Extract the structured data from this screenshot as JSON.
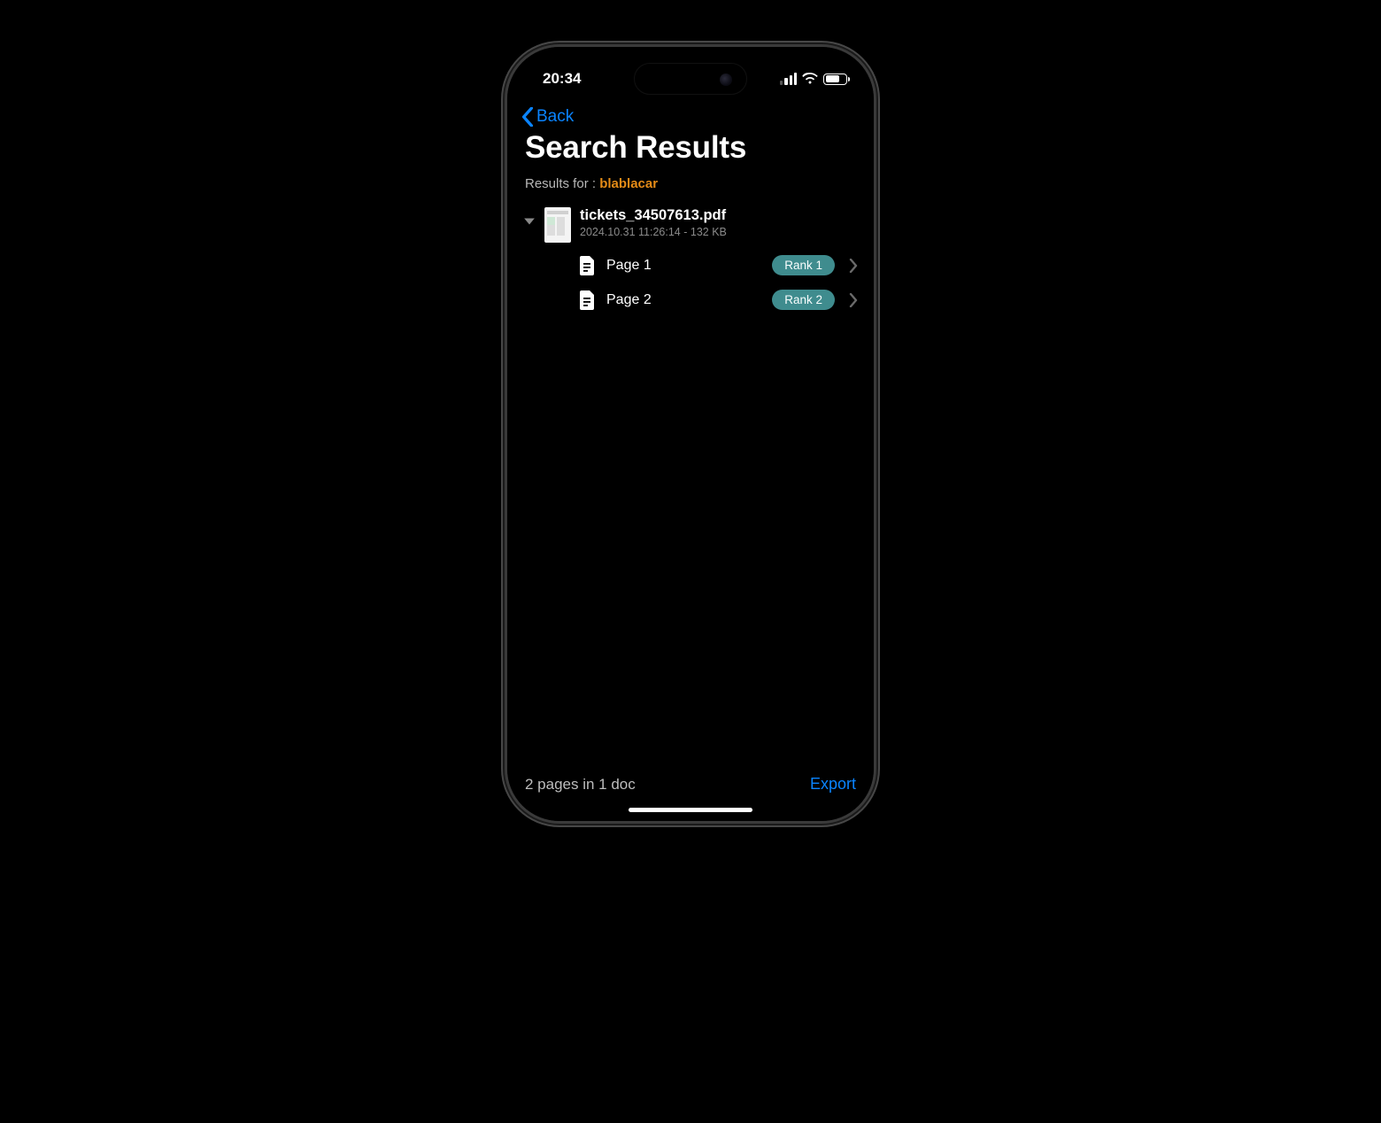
{
  "status": {
    "time": "20:34"
  },
  "nav": {
    "back_label": "Back"
  },
  "title": "Search Results",
  "results": {
    "prefix": "Results for : ",
    "query": "blablacar"
  },
  "document": {
    "filename": "tickets_34507613.pdf",
    "meta": "2024.10.31 11:26:14 - 132 KB",
    "pages": [
      {
        "label": "Page 1",
        "rank": "Rank 1"
      },
      {
        "label": "Page 2",
        "rank": "Rank 2"
      }
    ]
  },
  "footer": {
    "summary": "2 pages in 1 doc",
    "export_label": "Export"
  },
  "colors": {
    "accent_blue": "#0a84ff",
    "query_orange": "#e58b17",
    "rank_teal": "#3f8c8e"
  }
}
